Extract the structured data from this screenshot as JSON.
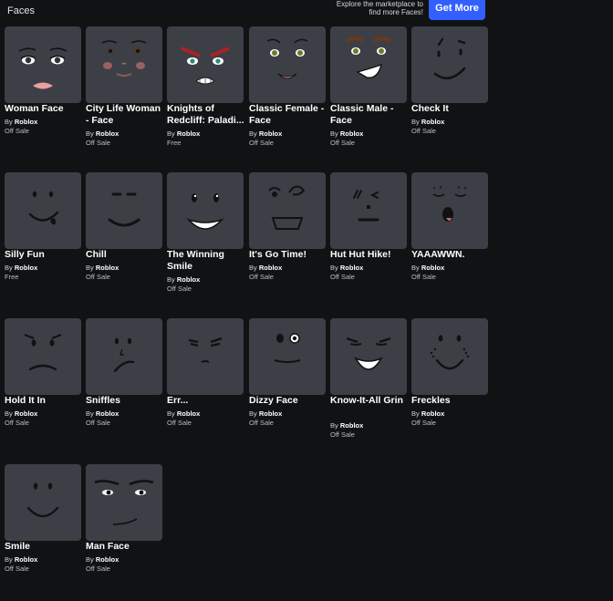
{
  "header": {
    "title": "Faces",
    "explore_line1": "Explore the marketplace to",
    "explore_line2": "find more Faces!",
    "get_more_label": "Get More"
  },
  "items": [
    {
      "name": "Woman Face",
      "by": "By",
      "creator": "Roblox",
      "price": "Off Sale",
      "face": "woman"
    },
    {
      "name": "City Life Woman - Face",
      "by": "By",
      "creator": "Roblox",
      "price": "Off Sale",
      "face": "citylife"
    },
    {
      "name": "Knights of Redcliff: Paladi...",
      "by": "By",
      "creator": "Roblox",
      "price": "Free",
      "face": "knight"
    },
    {
      "name": "Classic Female - Face",
      "by": "By",
      "creator": "Roblox",
      "price": "Off Sale",
      "face": "classicfemale"
    },
    {
      "name": "Classic Male - Face",
      "by": "By",
      "creator": "Roblox",
      "price": "Off Sale",
      "face": "classicmale"
    },
    {
      "name": "Check It",
      "by": "By",
      "creator": "Roblox",
      "price": "Off Sale",
      "face": "checkit"
    },
    {
      "name": "Silly Fun",
      "by": "By",
      "creator": "Roblox",
      "price": "Free",
      "face": "sillyfun"
    },
    {
      "name": "Chill",
      "by": "By",
      "creator": "Roblox",
      "price": "Off Sale",
      "face": "chill"
    },
    {
      "name": "The Winning Smile",
      "by": "By",
      "creator": "Roblox",
      "price": "Off Sale",
      "face": "winning"
    },
    {
      "name": "It's Go Time!",
      "by": "By",
      "creator": "Roblox",
      "price": "Off Sale",
      "face": "gotime"
    },
    {
      "name": "Hut Hut Hike!",
      "by": "By",
      "creator": "Roblox",
      "price": "Off Sale",
      "face": "huthut"
    },
    {
      "name": "YAAAWWN.",
      "by": "By",
      "creator": "Roblox",
      "price": "Off Sale",
      "face": "yawn"
    },
    {
      "name": "Hold It In",
      "by": "By",
      "creator": "Roblox",
      "price": "Off Sale",
      "face": "holdit"
    },
    {
      "name": "Sniffles",
      "by": "By",
      "creator": "Roblox",
      "price": "Off Sale",
      "face": "sniffles"
    },
    {
      "name": "Err...",
      "by": "By",
      "creator": "Roblox",
      "price": "Off Sale",
      "face": "err"
    },
    {
      "name": "Dizzy Face",
      "by": "By",
      "creator": "Roblox",
      "price": "Off Sale",
      "face": "dizzy"
    },
    {
      "name": "Know-It-All Grin",
      "by": "By",
      "creator": "Roblox",
      "price": "Off Sale",
      "face": "knowitall"
    },
    {
      "name": "Freckles",
      "by": "By",
      "creator": "Roblox",
      "price": "Off Sale",
      "face": "freckles"
    },
    {
      "name": "Smile",
      "by": "By",
      "creator": "Roblox",
      "price": "Off Sale",
      "face": "smile"
    },
    {
      "name": "Man Face",
      "by": "By",
      "creator": "Roblox",
      "price": "Off Sale",
      "face": "man"
    }
  ]
}
